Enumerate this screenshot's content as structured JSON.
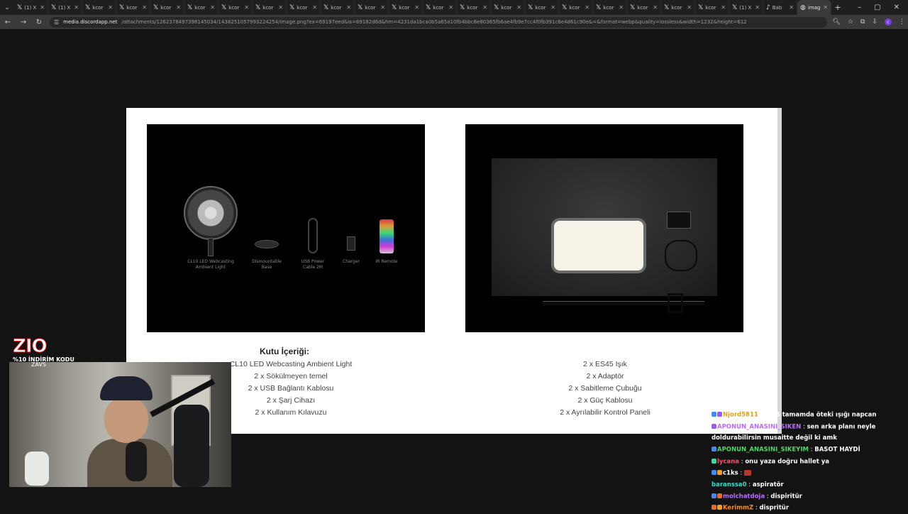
{
  "browser": {
    "tabs": [
      {
        "icon": "x-icon",
        "title": "(1) X",
        "active": false
      },
      {
        "icon": "x-icon",
        "title": "(1) X",
        "active": false
      },
      {
        "icon": "x-icon",
        "title": "kcor",
        "active": false
      },
      {
        "icon": "x-icon",
        "title": "kcor",
        "active": false
      },
      {
        "icon": "x-icon",
        "title": "kcor",
        "active": false
      },
      {
        "icon": "x-icon",
        "title": "kcor",
        "active": false
      },
      {
        "icon": "x-icon",
        "title": "kcor",
        "active": false
      },
      {
        "icon": "x-icon",
        "title": "kcor",
        "active": false
      },
      {
        "icon": "x-icon",
        "title": "kcor",
        "active": false
      },
      {
        "icon": "x-icon",
        "title": "kcor",
        "active": false
      },
      {
        "icon": "x-icon",
        "title": "kcor",
        "active": false
      },
      {
        "icon": "x-icon",
        "title": "kcor",
        "active": false
      },
      {
        "icon": "x-icon",
        "title": "kcor",
        "active": false
      },
      {
        "icon": "x-icon",
        "title": "kcor",
        "active": false
      },
      {
        "icon": "x-icon",
        "title": "kcor",
        "active": false
      },
      {
        "icon": "x-icon",
        "title": "kcor",
        "active": false
      },
      {
        "icon": "x-icon",
        "title": "kcor",
        "active": false
      },
      {
        "icon": "x-icon",
        "title": "kcor",
        "active": false
      },
      {
        "icon": "x-icon",
        "title": "kcor",
        "active": false
      },
      {
        "icon": "x-icon",
        "title": "kcor",
        "active": false
      },
      {
        "icon": "x-icon",
        "title": "kcor",
        "active": false
      },
      {
        "icon": "x-icon",
        "title": "(1) X",
        "active": false
      },
      {
        "icon": "tiktok-icon",
        "title": "Bab",
        "active": false
      },
      {
        "icon": "globe-icon",
        "title": "imag",
        "active": true
      }
    ],
    "url_host": "media.discordapp.net",
    "url_path": "/attachments/1262378497398145034/1438251057993224254/image.png?ex=69197eed&is=69182d6d&hm=4231da1bca0b5a65a10fb4bbc8e80365fb6ae4fb9e7cc4f0fb391c6e4d61c90e&=&format=webp&quality=lossless&width=1232&height=612",
    "profile_initial": "c"
  },
  "product": {
    "left_items": [
      {
        "label": "CL10 LED Webcasting Ambient Light"
      },
      {
        "label": "Dismountable Base"
      },
      {
        "label": "USB Power Cable 2M"
      },
      {
        "label": "Charger"
      },
      {
        "label": "IR Remote"
      }
    ],
    "contents_title": "Kutu İçeriği:",
    "left_list": [
      "CL10 LED Webcasting Ambient Light",
      "2 x Sökülmeyen temel",
      "2 x USB Bağlantı Kablosu",
      "2 x Şarj Cihazı",
      "2 x Kullanım Kılavuzu"
    ],
    "right_list": [
      "2 x ES45 Işık",
      "2 x Adaptör",
      "2 x Sabitleme Çubuğu",
      "2 x Güç Kablosu",
      "2 x Ayrılabilir Kontrol Paneli"
    ]
  },
  "overlay": {
    "brand_logo": "ZIO",
    "brand_promo": "%10 İNDİRİM KODU",
    "brand_sub": "ZAVS"
  },
  "chat": [
    {
      "user": "Njord5811",
      "user_color": "#d9a520",
      "badges": [
        "#3d8bff",
        "#9b59ff"
      ],
      "text": "es45 tamamda öteki ışığı napcan"
    },
    {
      "user": "APONUN_ANASINI_SIKEN",
      "user_color": "#b96cff",
      "badges": [
        "#9b59ff"
      ],
      "text": "sen arka planı neyle doldurabilirsin musaitte değil ki amk"
    },
    {
      "user": "APONUN_ANASINI_SIKEYIM",
      "user_color": "#4cd964",
      "badges": [
        "#3d8bff"
      ],
      "text": "BASOT HAYDİ"
    },
    {
      "user": "lycana",
      "user_color": "#ff4d6d",
      "badges": [
        "#3dd6a8"
      ],
      "text": "onu yaza doğru hallet ya"
    },
    {
      "user": "c1ks",
      "user_color": "#ffffff",
      "badges": [
        "#3d8bff",
        "#f0a020"
      ],
      "text": "",
      "emote": true
    },
    {
      "user": "baranssa0",
      "user_color": "#3dd6c8",
      "badges": [],
      "text": "aspiratör"
    },
    {
      "user": "molchatdoja",
      "user_color": "#b96cff",
      "badges": [
        "#3d8bff",
        "#f06a20"
      ],
      "text": "dispiritür"
    },
    {
      "user": "KerimmZ",
      "user_color": "#ff8c1a",
      "badges": [
        "#f06a20",
        "#f0a020"
      ],
      "text": "dispritür"
    }
  ]
}
